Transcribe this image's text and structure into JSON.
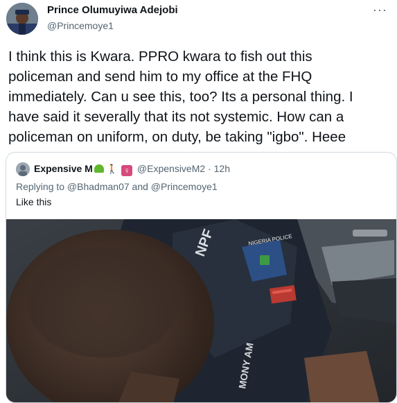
{
  "tweet": {
    "author_name": "Prince Olumuyiwa Adejobi",
    "author_handle": "@Princemoye1",
    "more_label": "···",
    "text": "I think this is Kwara. PPRO kwara to fish out this\npoliceman and send him to my office at the FHQ\nimmediately. Can u see this, too? Its a personal thing. I\nhave said it severally that its not systemic. How can a\npoliceman on uniform, on duty, be taking \"igbo\". Heee"
  },
  "quoted_tweet": {
    "author_name": "Expensive M",
    "emoji_female": "♀",
    "author_handle": "@ExpensiveM2",
    "separator": "·",
    "time": "12h",
    "replying_to": "Replying to @Bhadman07 and @Princemoye1",
    "text": "Like this",
    "photo_text_npf": "NPF",
    "photo_text_badge": "NIGERIA POLICE",
    "photo_text_name": "MONY AM"
  },
  "icons": {
    "avatar": "profile-photo-police-uniform",
    "more": "more-horizontal-icon",
    "heart": "green-heart-emoji",
    "person": "person-emoji",
    "female": "female-sign-emoji"
  }
}
